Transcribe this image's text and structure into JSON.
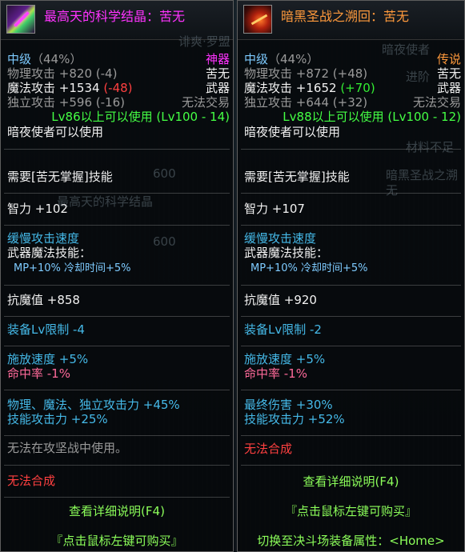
{
  "panels": [
    {
      "title": "最高天的科学结晶：苦无",
      "grade": "中级",
      "grade_pct": "（44%）",
      "rarity": "神器",
      "stats": [
        {
          "label": "物理攻击",
          "value": "+820",
          "diff": "(-4)"
        },
        {
          "label": "魔法攻击",
          "value": "+1534",
          "diff": "(-48)"
        },
        {
          "label": "独立攻击",
          "value": "+596",
          "diff": "(-16)"
        }
      ],
      "type1": "苦无",
      "type2": "武器",
      "trade": "无法交易",
      "level_req": "Lv86以上可以使用 (Lv100 - 14)",
      "job": "暗夜使者可以使用",
      "skill_req": "需要[苦无掌握]技能",
      "int": "智力 +102",
      "atk_speed": "缓慢攻击速度",
      "weapon_skill": "武器魔法技能：",
      "weapon_skill_detail": "MP+10% 冷却时间+5%",
      "magic_resist": "抗魔值 +858",
      "lv_limit": "装备Lv限制 -4",
      "cast_speed": "施放速度 +5%",
      "hit_rate": "命中率 -1%",
      "bonus1": "物理、魔法、独立攻击力 +45%",
      "bonus2": "技能攻击力 +25%",
      "no_pvp": "无法在攻坚战中使用。",
      "no_craft": "无法合成",
      "detail": "查看详细说明(F4)",
      "buy": "『点击鼠标左键可购买』",
      "ghost_texts": [
        "诽爽·罗盟",
        "600",
        "最高天的科学结晶",
        "600"
      ]
    },
    {
      "title": "暗黑圣战之溯回：苦无",
      "grade": "中级",
      "grade_pct": "（44%）",
      "rarity": "传说",
      "stats": [
        {
          "label": "物理攻击",
          "value": "+872",
          "diff": "(+48)"
        },
        {
          "label": "魔法攻击",
          "value": "+1652",
          "diff": "(+70)"
        },
        {
          "label": "独立攻击",
          "value": "+644",
          "diff": "(+32)"
        }
      ],
      "type1": "苦无",
      "type2": "武器",
      "trade": "无法交易",
      "level_req": "Lv88以上可以使用 (Lv100 - 12)",
      "job": "暗夜使者可以使用",
      "skill_req": "需要[苦无掌握]技能",
      "int": "智力 +107",
      "atk_speed": "缓慢攻击速度",
      "weapon_skill": "武器魔法技能：",
      "weapon_skill_detail": "MP+10% 冷却时间+5%",
      "magic_resist": "抗魔值 +920",
      "lv_limit": "装备Lv限制 -2",
      "cast_speed": "施放速度 +5%",
      "hit_rate": "命中率 -1%",
      "bonus1": "最终伤害 +30%",
      "bonus2": "技能攻击力 +52%",
      "no_craft": "无法合成",
      "detail": "查看详细说明(F4)",
      "buy": "『点击鼠标左键可购买』",
      "switch": "切换至决斗场装备属性：<Home>",
      "ghost_texts": [
        "暗夜使者",
        "进阶",
        "材料不足",
        "暗黑圣战之溯",
        "无"
      ]
    }
  ],
  "colors": {
    "pink": "#ff33ff",
    "orange": "#ff9a3c",
    "red": "#ff4040",
    "green": "#33ee33",
    "blue": "#45b9e8"
  }
}
